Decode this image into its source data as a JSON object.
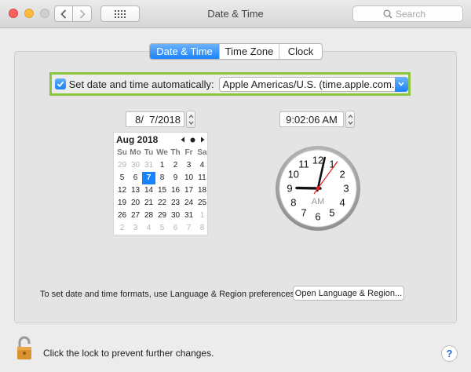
{
  "window": {
    "title": "Date & Time",
    "search_placeholder": "Search"
  },
  "tabs": [
    {
      "label": "Date & Time",
      "active": true
    },
    {
      "label": "Time Zone",
      "active": false
    },
    {
      "label": "Clock",
      "active": false
    }
  ],
  "auto": {
    "checked": true,
    "label": "Set date and time automatically:",
    "server": "Apple Americas/U.S. (time.apple.com.)"
  },
  "date_field": "8/  7/2018",
  "time_field": "9:02:06 AM",
  "calendar": {
    "month": "Aug 2018",
    "weekdays": [
      "Su",
      "Mo",
      "Tu",
      "We",
      "Th",
      "Fr",
      "Sa"
    ],
    "days": [
      [
        "29",
        "30",
        "31",
        "1",
        "2",
        "3",
        "4"
      ],
      [
        "5",
        "6",
        "7",
        "8",
        "9",
        "10",
        "11"
      ],
      [
        "12",
        "13",
        "14",
        "15",
        "16",
        "17",
        "18"
      ],
      [
        "19",
        "20",
        "21",
        "22",
        "23",
        "24",
        "25"
      ],
      [
        "26",
        "27",
        "28",
        "29",
        "30",
        "31",
        "1"
      ],
      [
        "2",
        "3",
        "4",
        "5",
        "6",
        "7",
        "8"
      ]
    ],
    "selected_day": "7"
  },
  "clock": {
    "numbers": [
      "12",
      "1",
      "2",
      "3",
      "4",
      "5",
      "6",
      "7",
      "8",
      "9",
      "10",
      "11"
    ],
    "ampm": "AM",
    "hours": 9,
    "minutes": 2,
    "seconds": 6
  },
  "footer": {
    "text": "To set date and time formats, use Language & Region preferences.",
    "button": "Open Language & Region..."
  },
  "lock_text": "Click the lock to prevent further changes.",
  "help_label": "?",
  "colors": {
    "accent": "#1a82fb",
    "highlight_border": "#8bc53f",
    "second_hand": "#e02020",
    "lock_body": "#d9922e"
  },
  "icons": {
    "back": "chevron-left-icon",
    "forward": "chevron-right-icon",
    "grid": "grid-icon",
    "search": "search-icon",
    "lock": "lock-icon",
    "help": "help-icon"
  }
}
